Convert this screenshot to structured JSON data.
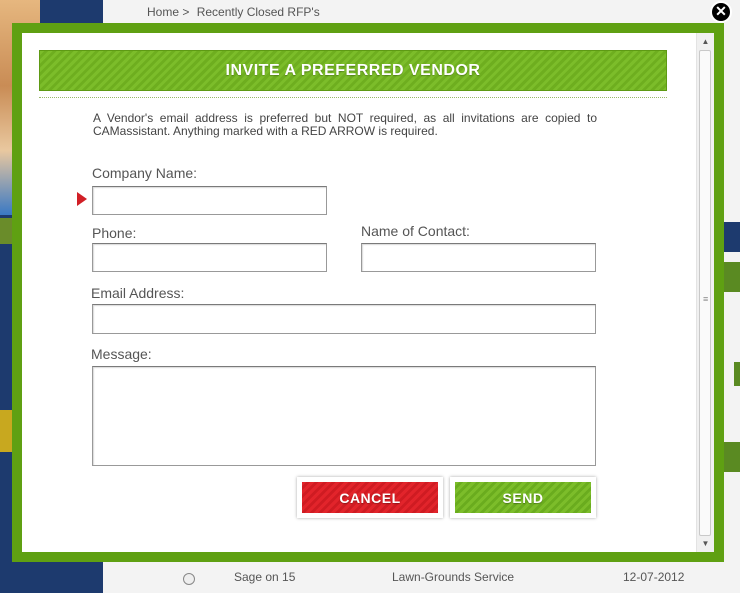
{
  "background": {
    "breadcrumb_home": "Home >",
    "breadcrumb_current": "Recently Closed RFP's",
    "row_name": "Sage on 15",
    "row_service": "Lawn-Grounds Service",
    "row_date": "12-07-2012"
  },
  "modal": {
    "close_glyph": "✕",
    "title": "INVITE A PREFERRED VENDOR",
    "intro": "A Vendor's email address is preferred but NOT required, as all invitations are copied to CAMassistant. Anything marked with a RED ARROW is required.",
    "fields": {
      "company_name": {
        "label": "Company Name:",
        "value": "",
        "required": true
      },
      "phone": {
        "label": "Phone:",
        "value": ""
      },
      "contact": {
        "label": "Name of Contact:",
        "value": ""
      },
      "email": {
        "label": "Email Address:",
        "value": ""
      },
      "message": {
        "label": "Message:",
        "value": ""
      }
    },
    "buttons": {
      "cancel": "CANCEL",
      "send": "SEND"
    }
  },
  "colors": {
    "accent_green": "#6eae1f",
    "cancel_red": "#e2242b",
    "required_arrow": "#d11f26"
  },
  "icons": {
    "close": "close-icon",
    "required": "red-arrow-icon",
    "scroll_up": "chevron-up-icon",
    "scroll_down": "chevron-down-icon"
  }
}
